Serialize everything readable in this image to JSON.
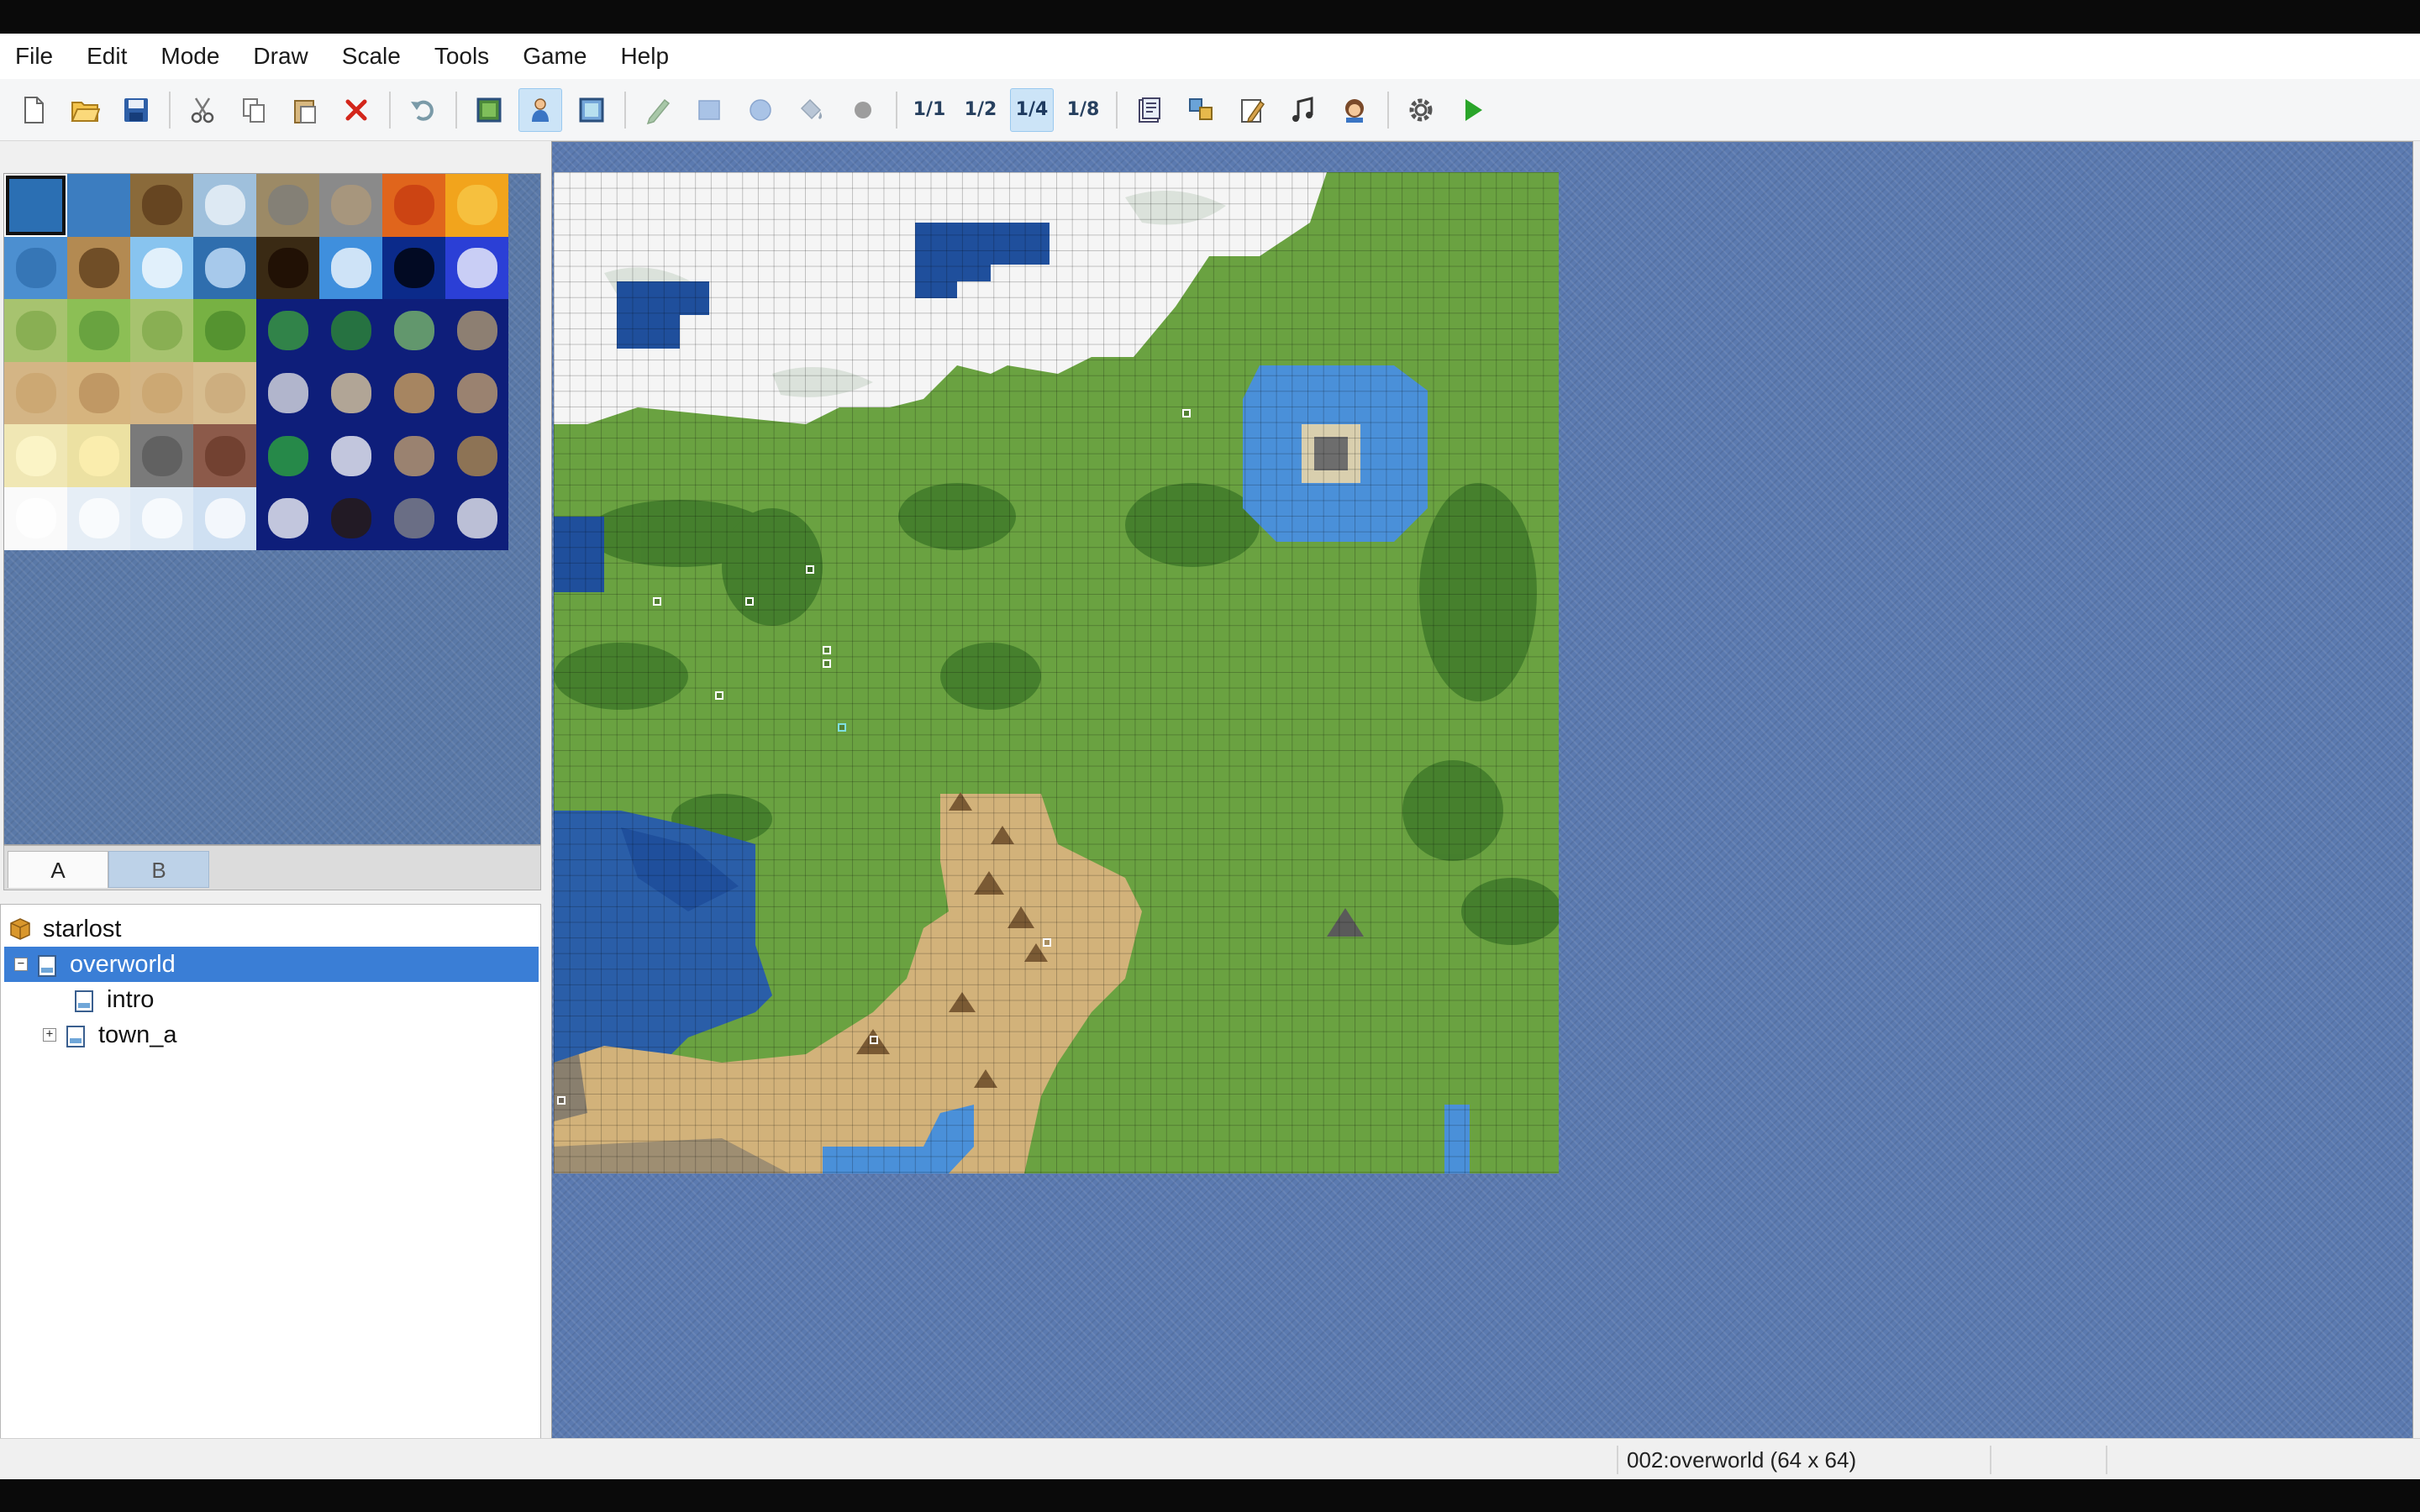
{
  "menu": [
    "File",
    "Edit",
    "Mode",
    "Draw",
    "Scale",
    "Tools",
    "Game",
    "Help"
  ],
  "toolbar": {
    "icons": [
      "new-file-icon",
      "open-folder-icon",
      "save-icon",
      "cut-icon",
      "copy-icon",
      "paste-icon",
      "delete-icon",
      "undo-icon",
      "layer-map-icon",
      "layer-event-icon",
      "layer-dim-icon",
      "pencil-icon",
      "rectangle-icon",
      "ellipse-icon",
      "flood-fill-icon",
      "shadow-pen-icon",
      "zoom-1-1-icon",
      "zoom-1-2-icon",
      "zoom-1-4-icon",
      "zoom-1-8-icon",
      "database-icon",
      "resource-manager-icon",
      "script-editor-icon",
      "sound-test-icon",
      "character-generator-icon",
      "options-icon",
      "playtest-icon"
    ],
    "zoom_labels": [
      "1/1",
      "1/2",
      "1/4",
      "1/8"
    ]
  },
  "tileset_tabs": [
    "A",
    "B"
  ],
  "tree": {
    "project": "starlost",
    "maps": [
      {
        "name": "overworld",
        "selected": true,
        "expander": "−"
      },
      {
        "name": "intro",
        "selected": false,
        "expander": ""
      },
      {
        "name": "town_a",
        "selected": false,
        "expander": "+"
      }
    ]
  },
  "status": {
    "map_info": "002:overworld (64 x 64)"
  },
  "colors": {
    "selection": "#3a7ed6",
    "grass": "#6aa241",
    "water": "#3b6db8",
    "snow": "#f4f4f4",
    "sand": "#d2b27a"
  }
}
